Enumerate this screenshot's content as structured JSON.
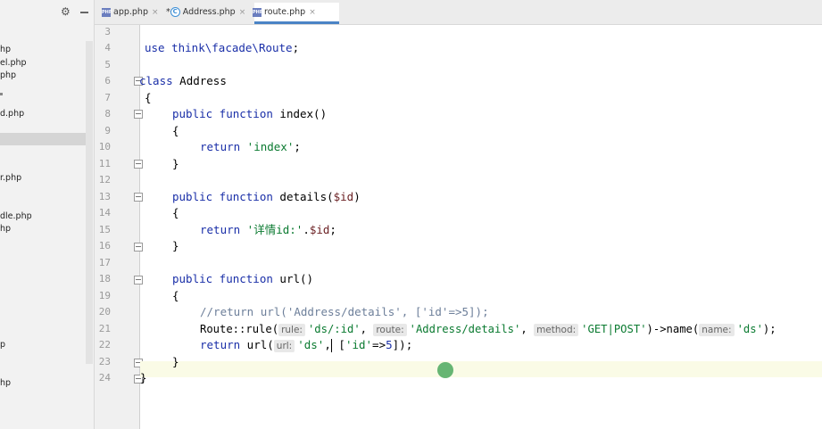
{
  "project_panel": {
    "files": [
      "hp",
      "el.php",
      "php",
      "",
      "d.php",
      "",
      "r.php",
      "dle.php",
      "hp",
      "p",
      "hp"
    ]
  },
  "tabs": [
    {
      "label": "app.php",
      "icon": "php-file-icon",
      "active": false,
      "modified": false
    },
    {
      "label": "Address.php",
      "icon": "class-file-icon",
      "active": true,
      "modified": true
    },
    {
      "label": "route.php",
      "icon": "php-file-icon",
      "active": false,
      "modified": false
    }
  ],
  "tab_prefix_modified": "*",
  "line_numbers": [
    "3",
    "4",
    "5",
    "6",
    "7",
    "8",
    "9",
    "10",
    "11",
    "12",
    "13",
    "14",
    "15",
    "16",
    "17",
    "18",
    "19",
    "20",
    "21",
    "22",
    "23",
    "24"
  ],
  "code": {
    "l4_kw": "use",
    "l4_ns": "think\\facade\\Route",
    "l4_end": ";",
    "l6_kw": "class",
    "l6_name": " Address",
    "l7": "{",
    "l8_kw": "public function",
    "l8_name": " index()",
    "l9": "{",
    "l10_kw": "return",
    "l10_str": " 'index'",
    "l10_end": ";",
    "l11": "}",
    "l13_kw": "public function",
    "l13_name": " details(",
    "l13_var": "$id",
    "l13_end": ")",
    "l14": "{",
    "l15_kw": "return",
    "l15_str": " '详情id:'",
    "l15_dot": ".",
    "l15_var": "$id",
    "l15_end": ";",
    "l16": "}",
    "l18_kw": "public function",
    "l18_name": " url()",
    "l19": "{",
    "l20_cmt": "//return url('Address/details', ['id'=>5]);",
    "l21_a": "Route::",
    "l21_b": "rule(",
    "l21_hint1": "rule:",
    "l21_str1": "'ds/:id'",
    "l21_sep1": ", ",
    "l21_hint2": "route:",
    "l21_str2": "'Address/details'",
    "l21_sep2": ", ",
    "l21_hint3": "method:",
    "l21_str3": "'GET|POST'",
    "l21_c": ")->",
    "l21_d": "name(",
    "l21_hint4": "name:",
    "l21_str4": "'ds'",
    "l21_e": ");",
    "l22_kw": "return",
    "l22_a": " url(",
    "l22_hint": "url:",
    "l22_str1": "'ds'",
    "l22_sep": ",",
    "l22_b": " [",
    "l22_str2": "'id'",
    "l22_c": "=>",
    "l22_num": "5",
    "l22_d": "]);",
    "l23": "}",
    "l24": "}"
  },
  "colors": {
    "keyword": "#1a2fa8",
    "string": "#0a7a30",
    "variable": "#6a1f22",
    "comment": "#6d7f9a",
    "active_tab_underline": "#4a83c5"
  }
}
